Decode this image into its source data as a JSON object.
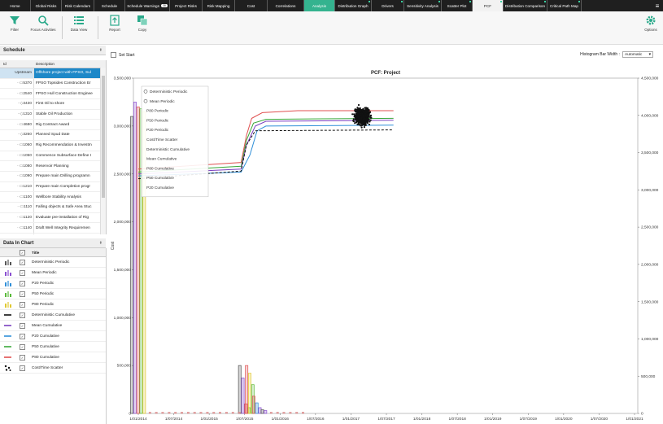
{
  "tabs": [
    {
      "label": "Home",
      "w": 38,
      "style": "dark"
    },
    {
      "label": "Global Risks",
      "w": 38,
      "style": "dark"
    },
    {
      "label": "Risk Calendars",
      "w": 40,
      "style": "dark"
    },
    {
      "label": "Schedule",
      "w": 38,
      "style": "dark"
    },
    {
      "label": "Schedule Warnings",
      "w": 55,
      "style": "dark",
      "badge": "38"
    },
    {
      "label": "Project Risks",
      "w": 40,
      "style": "dark"
    },
    {
      "label": "Risk Mapping",
      "w": 40,
      "style": "dark"
    },
    {
      "label": "Cost",
      "w": 40,
      "style": "dark"
    },
    {
      "label": "Correlations",
      "w": 45,
      "style": "dark"
    },
    {
      "label": "Analysis",
      "w": 38,
      "style": "teal"
    },
    {
      "label": "Distribution Graph",
      "w": 45,
      "style": "dark",
      "dot": true
    },
    {
      "label": "Drivers",
      "w": 40,
      "style": "dark",
      "dot": true
    },
    {
      "label": "Sensitivity Analysis",
      "w": 46,
      "style": "dark",
      "dot": true
    },
    {
      "label": "Scatter Plot",
      "w": 38,
      "style": "dark",
      "dot": true
    },
    {
      "label": "PCF",
      "w": 38,
      "style": "active",
      "dot": true
    },
    {
      "label": "Distribution Comparison",
      "w": 54,
      "style": "dark",
      "dot": true
    },
    {
      "label": "Critical Path Map",
      "w": 42,
      "style": "dark",
      "dot": true
    }
  ],
  "toolbar": {
    "filter": "Filter",
    "focus": "Focus Activities",
    "dataview": "Data View",
    "report": "Report",
    "copy": "Copy",
    "options": "Options"
  },
  "schedule": {
    "title": "Schedule",
    "col_id": "Id",
    "col_desc": "Description",
    "rows": [
      {
        "id": "Upstream",
        "desc": "Offshore project with FPSO, Sul",
        "sel": true,
        "mark": ""
      },
      {
        "id": "5370",
        "desc": "FPSO Topsides Construction Er",
        "mark": "▭"
      },
      {
        "id": "2540",
        "desc": "FPSO Hull Construction Enginee",
        "mark": "▭"
      },
      {
        "id": "3430",
        "desc": "First Oil to shore",
        "mark": "◇"
      },
      {
        "id": "1310",
        "desc": "Stable Oil Production",
        "mark": "◇"
      },
      {
        "id": "4680",
        "desc": "Rig Contract Award",
        "mark": "▭"
      },
      {
        "id": "3260",
        "desc": "Planned Spud Date",
        "mark": "◇"
      },
      {
        "id": "1060",
        "desc": "Rig Recommendation & Investm",
        "mark": "▭"
      },
      {
        "id": "1050",
        "desc": "Commence Subsurface Define I",
        "mark": "▭"
      },
      {
        "id": "1080",
        "desc": "Reservoir Planning",
        "mark": "▭"
      },
      {
        "id": "1090",
        "desc": "Prepare main Drilling programn",
        "mark": "▭"
      },
      {
        "id": "1210",
        "desc": "Prepare main Completion progr",
        "mark": "▭"
      },
      {
        "id": "1100",
        "desc": "Wellbore Stability Analysis",
        "mark": "▭"
      },
      {
        "id": "1110",
        "desc": "Falling objects & Safe Area Stuc",
        "mark": "▭"
      },
      {
        "id": "1120",
        "desc": "Evaluate pre-installation of Rig",
        "mark": "▭"
      },
      {
        "id": "1140",
        "desc": "Draft Well Integrity Requiremen",
        "mark": "▭"
      },
      {
        "id": "1170",
        "desc": "Draft SIMOPS Guidelines",
        "mark": "▭"
      }
    ]
  },
  "data_in_chart": {
    "title": "Data In Chart",
    "col_title": "Title",
    "rows": [
      {
        "title": "Deterministic Periodic",
        "color": "#555555",
        "kind": "bar"
      },
      {
        "title": "Mean Periodic",
        "color": "#8a4fd0",
        "kind": "bar"
      },
      {
        "title": "P20 Periodic",
        "color": "#2f8fd8",
        "kind": "bar"
      },
      {
        "title": "P50 Periodic",
        "color": "#5aba3a",
        "kind": "bar"
      },
      {
        "title": "P80 Periodic",
        "color": "#e0c830",
        "kind": "bar"
      },
      {
        "title": "Deterministic Cumulative",
        "color": "#111111",
        "kind": "line"
      },
      {
        "title": "Mean Cumulative",
        "color": "#7a3fc0",
        "kind": "line"
      },
      {
        "title": "P20 Cumulative",
        "color": "#2f8fd8",
        "kind": "line"
      },
      {
        "title": "P50 Cumulative",
        "color": "#3aa83a",
        "kind": "line"
      },
      {
        "title": "P80 Cumulative",
        "color": "#e05050",
        "kind": "line"
      },
      {
        "title": "Cost/Time Scatter",
        "color": "#111111",
        "kind": "scatter"
      }
    ]
  },
  "controls": {
    "set_start": "Set Start",
    "hbw_label": "Histogram Bar Width :",
    "hbw_value": "Automatic"
  },
  "chart_data": {
    "type": "bar+line+scatter",
    "title": "PCF: Project",
    "ylabel": "Cost",
    "ylim": [
      0,
      3500000
    ],
    "y2lim": [
      0,
      4500000
    ],
    "y_ticks": [
      "0",
      "500,000",
      "1,000,000",
      "1,500,000",
      "2,000,000",
      "2,500,000",
      "3,000,000",
      "3,500,000"
    ],
    "y2_ticks": [
      "0",
      "500,000",
      "1,000,000",
      "1,500,000",
      "2,000,000",
      "2,500,000",
      "3,000,000",
      "3,500,000",
      "4,000,000",
      "4,500,000"
    ],
    "x_ticks": [
      "1/01/2014",
      "1/07/2014",
      "1/01/2015",
      "1/07/2015",
      "1/01/2016",
      "1/07/2016",
      "1/01/2017",
      "1/07/2017",
      "1/01/2018",
      "1/07/2018",
      "1/01/2019",
      "1/07/2019",
      "1/01/2020",
      "1/07/2020",
      "1/01/2021"
    ],
    "legend": {
      "placement": "top-left",
      "items": [
        {
          "label": "Deterministic Periodic",
          "marker": "circle"
        },
        {
          "label": "Mean Periodic",
          "marker": "circle"
        },
        {
          "label": "P80 Periodic"
        },
        {
          "label": "P50 Periodic"
        },
        {
          "label": "P20 Periodic"
        },
        {
          "label": "Cost/Time Scatter"
        },
        {
          "label": "Deterministic Cumulative"
        },
        {
          "label": "Mean Cumulative"
        },
        {
          "label": "P80 Cumulative"
        },
        {
          "label": "P50 Cumulative"
        },
        {
          "label": "P20 Cumulative"
        }
      ]
    },
    "bar_groups": [
      {
        "x": 0.0,
        "values": [
          {
            "v": 3100000,
            "c": "#555555"
          },
          {
            "v": 3250000,
            "c": "#8a4fd0"
          },
          {
            "v": 3200000,
            "c": "#e05050"
          },
          {
            "v": 3180000,
            "c": "#5aba3a"
          },
          {
            "v": 3150000,
            "c": "#e0c830"
          }
        ]
      },
      {
        "x": 3.0,
        "values": [
          {
            "v": 500000,
            "c": "#555555"
          },
          {
            "v": 370000,
            "c": "#8a4fd0"
          },
          {
            "v": 100000,
            "c": "#e05050"
          },
          {
            "v": 60000,
            "c": "#5aba3a"
          }
        ]
      },
      {
        "x": 3.15,
        "values": [
          {
            "v": 500000,
            "c": "#e05050"
          },
          {
            "v": 420000,
            "c": "#e0c830"
          },
          {
            "v": 300000,
            "c": "#5aba3a"
          }
        ]
      },
      {
        "x": 3.35,
        "values": [
          {
            "v": 180000,
            "c": "#e05050"
          },
          {
            "v": 110000,
            "c": "#2f8fd8"
          },
          {
            "v": 60000,
            "c": "#8a4fd0"
          }
        ]
      },
      {
        "x": 3.55,
        "values": [
          {
            "v": 40000,
            "c": "#555555"
          },
          {
            "v": 30000,
            "c": "#8a4fd0"
          }
        ]
      }
    ],
    "series": [
      {
        "name": "P80 Cumulative",
        "color": "#e05050",
        "dash": false,
        "points": [
          [
            0,
            2550000
          ],
          [
            2.9,
            2620000
          ],
          [
            3.05,
            2900000
          ],
          [
            3.2,
            3080000
          ],
          [
            3.5,
            3140000
          ],
          [
            4.5,
            3160000
          ],
          [
            7.2,
            3160000
          ]
        ]
      },
      {
        "name": "P50 Cumulative",
        "color": "#3aa83a",
        "dash": false,
        "points": [
          [
            0,
            2520000
          ],
          [
            2.9,
            2580000
          ],
          [
            3.05,
            2850000
          ],
          [
            3.25,
            3030000
          ],
          [
            3.6,
            3070000
          ],
          [
            7.2,
            3080000
          ]
        ]
      },
      {
        "name": "Mean Cumulative",
        "color": "#7a3fc0",
        "dash": false,
        "points": [
          [
            0,
            2500000
          ],
          [
            2.9,
            2550000
          ],
          [
            3.05,
            2800000
          ],
          [
            3.3,
            3000000
          ],
          [
            3.6,
            3050000
          ],
          [
            7.2,
            3060000
          ]
        ]
      },
      {
        "name": "P20 Cumulative",
        "color": "#2f8fd8",
        "dash": false,
        "points": [
          [
            0,
            2480000
          ],
          [
            2.9,
            2520000
          ],
          [
            3.15,
            2700000
          ],
          [
            3.35,
            2950000
          ],
          [
            3.6,
            3000000
          ],
          [
            7.2,
            3010000
          ]
        ]
      },
      {
        "name": "Deterministic Cumulative",
        "color": "#111111",
        "dash": true,
        "points": [
          [
            0,
            2450000
          ],
          [
            2.9,
            2530000
          ],
          [
            3.05,
            2800000
          ],
          [
            3.3,
            2950000
          ],
          [
            7.2,
            2960000
          ]
        ]
      }
    ],
    "scatter": {
      "x_center": 6.33,
      "x_spread": 0.18,
      "y_center": 3100000,
      "y_spread": 70000,
      "count": 650
    }
  }
}
